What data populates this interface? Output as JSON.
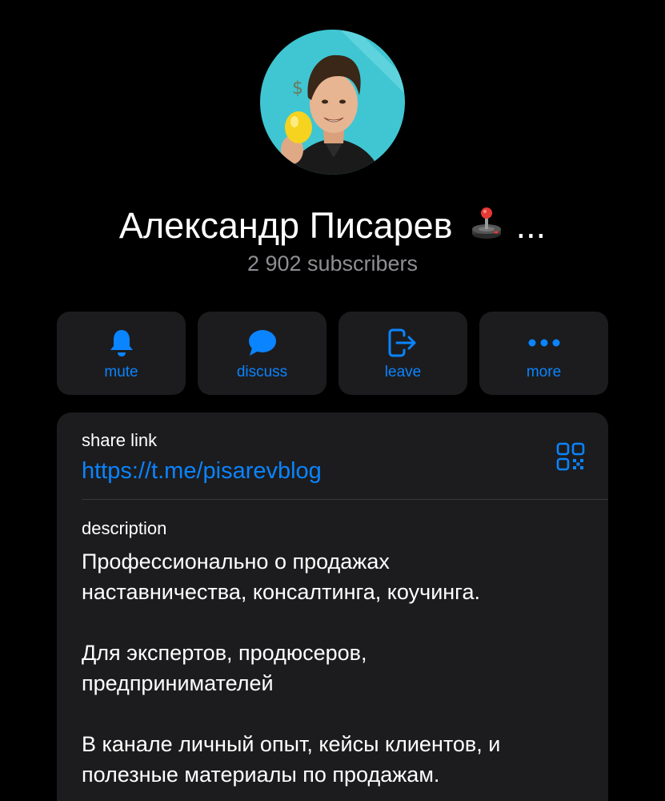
{
  "channel": {
    "name": "Александр Писарев",
    "name_suffix": "...",
    "subscribers": "2 902 subscribers"
  },
  "actions": [
    {
      "label": "mute",
      "icon": "bell-icon"
    },
    {
      "label": "discuss",
      "icon": "chat-bubble-icon"
    },
    {
      "label": "leave",
      "icon": "leave-icon"
    },
    {
      "label": "more",
      "icon": "more-icon"
    }
  ],
  "share": {
    "label": "share link",
    "url": "https://t.me/pisarevblog"
  },
  "description": {
    "label": "description",
    "paragraphs": [
      [
        "Профессионально о продажах",
        "наставничества, консалтинга, коучинга."
      ],
      [
        "Для экспертов, продюсеров,",
        "предпринимателей"
      ],
      [
        "В канале личный опыт, кейсы клиентов, и",
        "полезные материалы по продажам."
      ]
    ]
  },
  "colors": {
    "background": "#000000",
    "card": "#1c1c1e",
    "accent": "#0a84ff",
    "secondary_text": "#8e8e93"
  }
}
